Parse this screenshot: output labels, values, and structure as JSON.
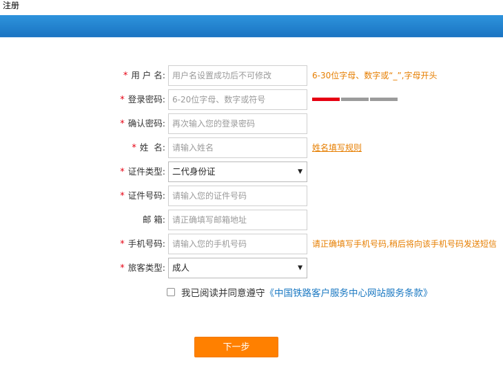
{
  "page": {
    "title": "注册"
  },
  "colors": {
    "banner": "#1a74c2",
    "required": "#e60012",
    "hint": "#e67e00",
    "link": "#1a78c2",
    "button": "#ff8000"
  },
  "form": {
    "required_mark": "*",
    "username": {
      "label": "用 户 名:",
      "placeholder": "用户名设置成功后不可修改",
      "hint": "6-30位字母、数字或“_”,字母开头"
    },
    "password": {
      "label": "登录密码:",
      "placeholder": "6-20位字母、数字或符号",
      "strength_colors": [
        "#e60012",
        "#9b9b9b",
        "#9b9b9b"
      ]
    },
    "confirm_password": {
      "label": "确认密码:",
      "placeholder": "再次输入您的登录密码"
    },
    "name": {
      "label": "姓  名:",
      "placeholder": "请输入姓名",
      "hint": "姓名填写规则"
    },
    "id_type": {
      "label": "证件类型:",
      "value": "二代身份证",
      "caret": "▼"
    },
    "id_number": {
      "label": "证件号码:",
      "placeholder": "请输入您的证件号码"
    },
    "email": {
      "label": "邮 箱:",
      "placeholder": "请正确填写邮箱地址"
    },
    "phone": {
      "label": "手机号码:",
      "placeholder": "请输入您的手机号码",
      "hint": "请正确填写手机号码,稍后将向该手机号码发送短信"
    },
    "passenger_type": {
      "label": "旅客类型:",
      "value": "成人",
      "caret": "▼"
    }
  },
  "agreement": {
    "text": "我已阅读并同意遵守",
    "terms": "《中国铁路客户服务中心网站服务条款》"
  },
  "next_button": {
    "label": "下一步"
  }
}
